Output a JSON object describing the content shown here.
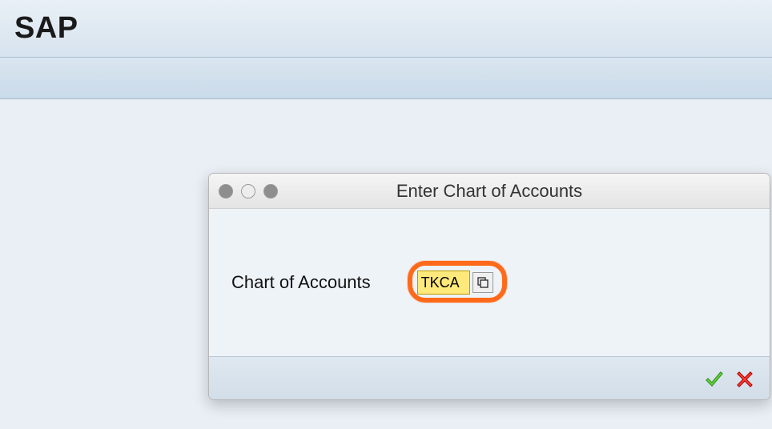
{
  "header": {
    "title": "SAP"
  },
  "dialog": {
    "title": "Enter Chart of Accounts",
    "field_label": "Chart of Accounts",
    "input_value": "TKCA"
  }
}
